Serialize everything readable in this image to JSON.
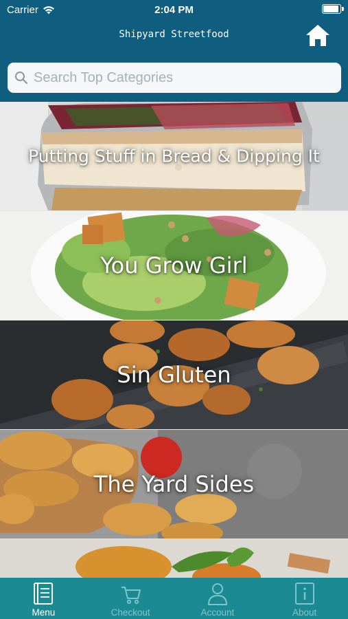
{
  "status_bar": {
    "carrier": "Carrier",
    "time": "2:04 PM"
  },
  "header": {
    "title": "Shipyard Streetfood",
    "home_icon": "home-icon"
  },
  "search": {
    "placeholder": "Search Top Categories",
    "value": ""
  },
  "categories": [
    {
      "label": "Putting Stuff in Bread & Dipping It"
    },
    {
      "label": "You Grow Girl"
    },
    {
      "label": "Sin Gluten"
    },
    {
      "label": "The Yard Sides"
    },
    {
      "label": ""
    }
  ],
  "tabs": [
    {
      "label": "Menu",
      "icon": "menu-book-icon",
      "active": true
    },
    {
      "label": "Checkout",
      "icon": "cart-icon",
      "active": false
    },
    {
      "label": "Account",
      "icon": "person-icon",
      "active": false
    },
    {
      "label": "About",
      "icon": "info-icon",
      "active": false
    }
  ],
  "colors": {
    "header_bg": "#0f5e7f",
    "tabbar_bg": "#1b8a93",
    "tab_active": "#ffffff",
    "tab_inactive": "#7fc6cc"
  }
}
